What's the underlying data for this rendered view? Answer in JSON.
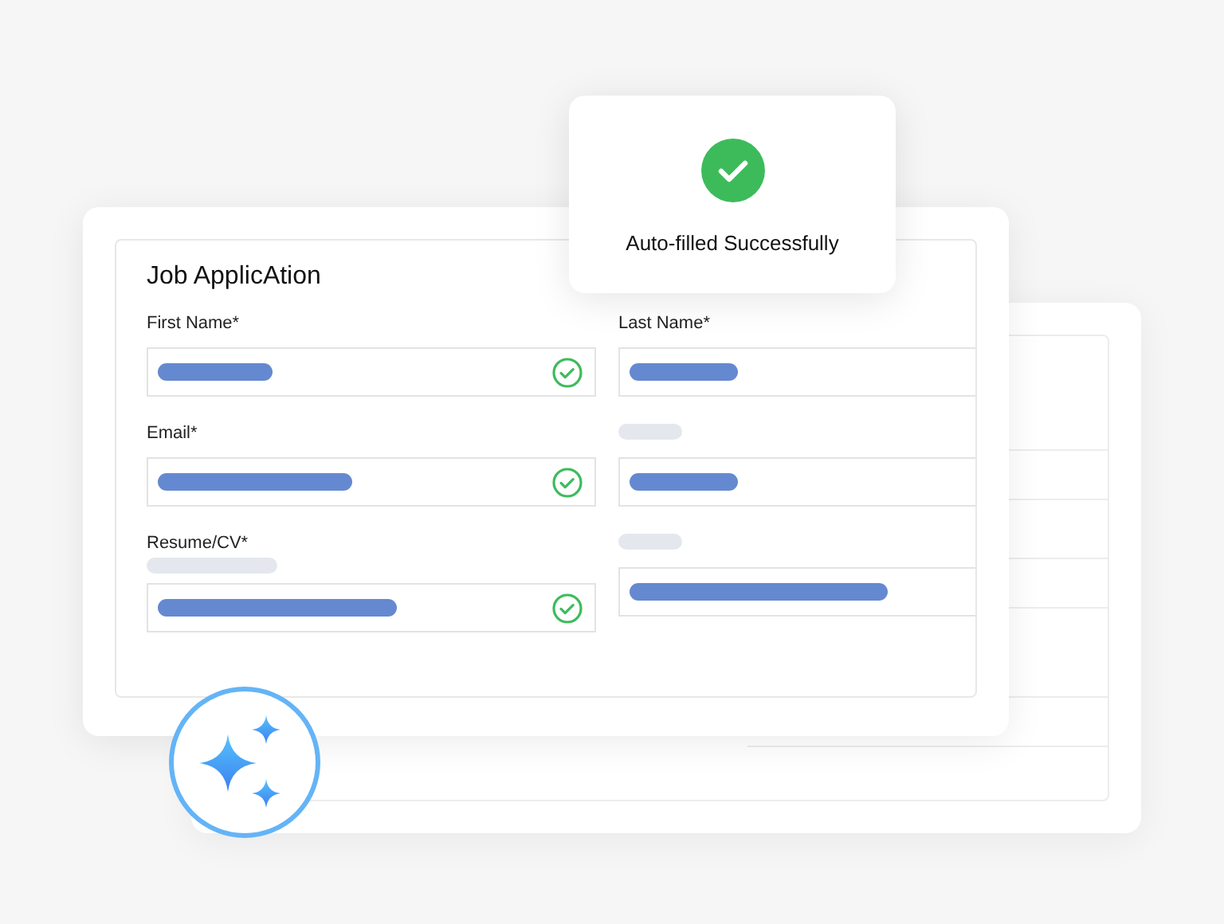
{
  "form": {
    "title": "Job ApplicAtion",
    "rows": [
      [
        {
          "label": "First Name*",
          "hint": false,
          "verified": true
        },
        {
          "label": "Last Name*",
          "hint": false,
          "verified": false
        }
      ],
      [
        {
          "label": "Email*",
          "hint": false,
          "verified": true
        },
        {
          "hint": true,
          "verified": false
        }
      ],
      [
        {
          "label": "Resume/CV*",
          "hint": true,
          "verified": true
        },
        {
          "hint": true,
          "verified": false
        }
      ]
    ]
  },
  "toast": {
    "message": "Auto-filled Successfully"
  }
}
